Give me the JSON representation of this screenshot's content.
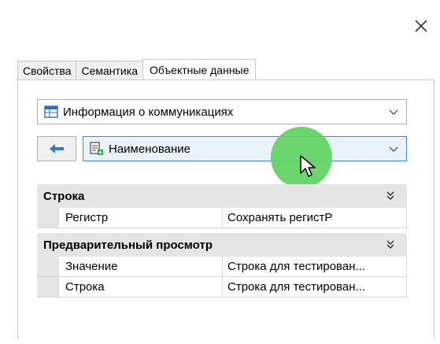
{
  "window": {
    "close_icon": "close-icon"
  },
  "tabs": [
    {
      "label": "Свойства",
      "active": false
    },
    {
      "label": "Семантика",
      "active": false
    },
    {
      "label": "Объектные данные",
      "active": true
    }
  ],
  "object_combo": {
    "label": "Информация о коммуникациях",
    "icon": "table-icon"
  },
  "semantic_combo": {
    "label": "Наименование",
    "icon": "add-field-icon"
  },
  "back_button": {
    "icon": "arrow-left-icon"
  },
  "sections": [
    {
      "title": "Строка",
      "rows": [
        {
          "key": "Регистр",
          "value": "Сохранять регистР"
        }
      ]
    },
    {
      "title": "Предварительный просмотр",
      "rows": [
        {
          "key": "Значение",
          "value": "Строка для тестирован..."
        },
        {
          "key": "Строка",
          "value": "Строка для тестирован..."
        }
      ]
    }
  ],
  "colors": {
    "accent_border": "#3c8fd6",
    "touch_indicator": "#5fd262",
    "section_bg": "#e5e5e5"
  }
}
